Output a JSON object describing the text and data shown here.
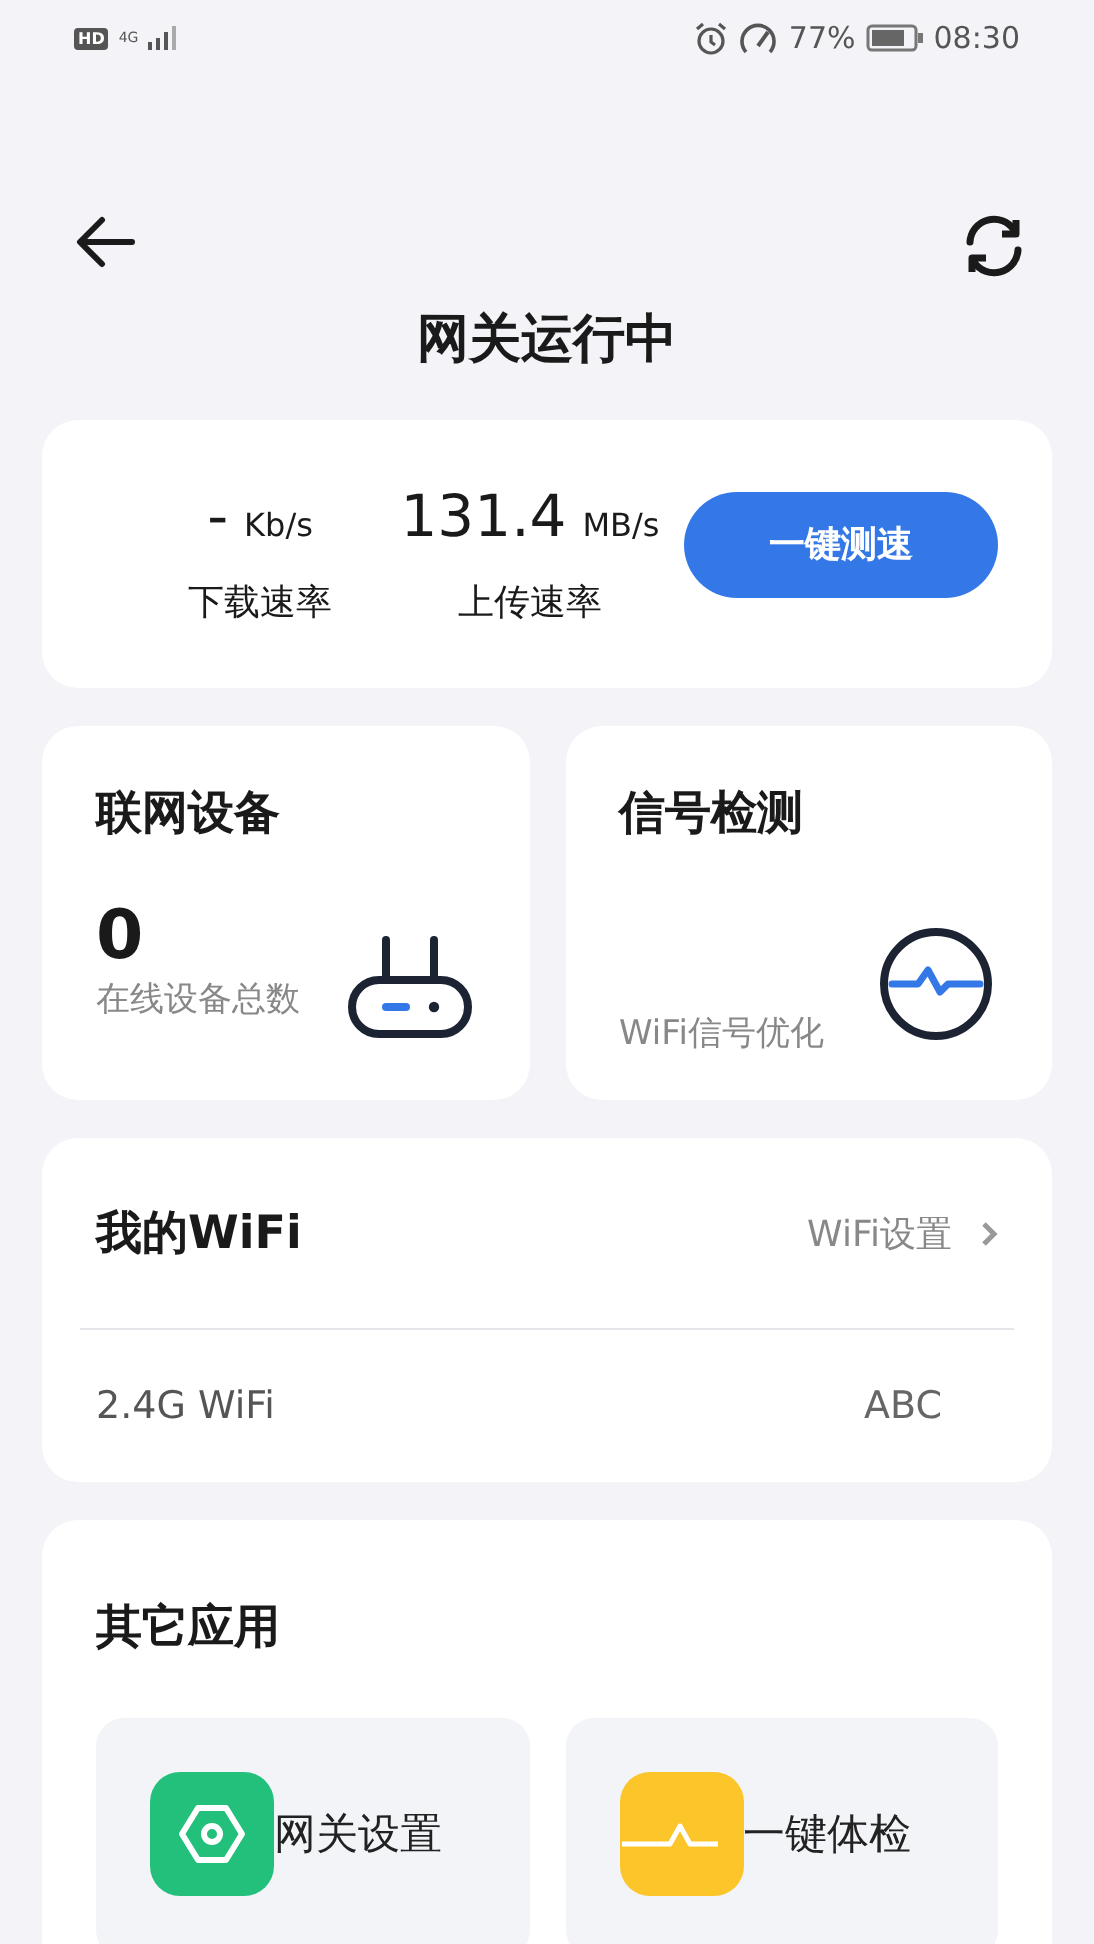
{
  "status_bar": {
    "hd": "HD",
    "network": "4G",
    "battery": "77%",
    "time": "08:30"
  },
  "header": {
    "title": "网关运行中"
  },
  "speed": {
    "stats": [
      {
        "value": "-",
        "unit": "Kb/s",
        "label": "下载速率"
      },
      {
        "value": "131.4",
        "unit": "MB/s",
        "label": "上传速率"
      }
    ],
    "button": "一键测速"
  },
  "devices": {
    "title": "联网设备",
    "count": "0",
    "caption": "在线设备总数"
  },
  "signal": {
    "title": "信号检测",
    "caption": "WiFi信号优化"
  },
  "wifi": {
    "title": "我的WiFi",
    "link": "WiFi设置",
    "rows": [
      {
        "name": "2.4G WiFi",
        "ssid": "ABC"
      }
    ]
  },
  "apps": {
    "title": "其它应用",
    "items": [
      {
        "label": "网关设置",
        "kind": "gear",
        "color": "#22c07a"
      },
      {
        "label": "一键体检",
        "kind": "pulse",
        "color": "#fcc52a"
      }
    ]
  }
}
